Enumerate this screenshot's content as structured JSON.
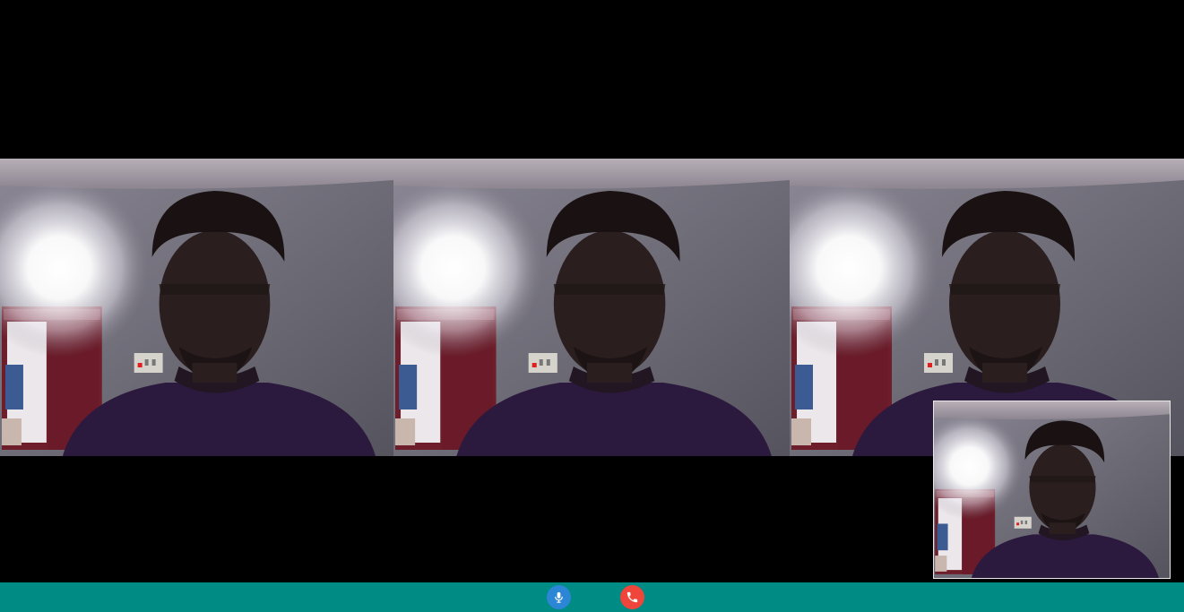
{
  "call": {
    "remote_feeds": [
      {
        "icon": "camera-feed"
      },
      {
        "icon": "camera-feed"
      },
      {
        "icon": "camera-feed"
      }
    ],
    "local_feed": {
      "icon": "self-view-feed"
    }
  },
  "controls": {
    "bar_color": "#008b84",
    "mic_button": {
      "icon": "microphone-icon",
      "color": "#2b86d6"
    },
    "hangup_button": {
      "icon": "phone-hangup-icon",
      "color": "#f0453a"
    }
  }
}
